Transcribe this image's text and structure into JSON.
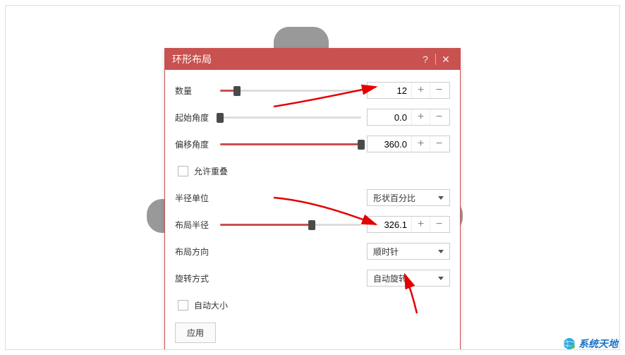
{
  "dialog": {
    "title": "环形布局",
    "rows": {
      "count": {
        "label": "数量",
        "value": "12",
        "slider_pct": 12
      },
      "startAngle": {
        "label": "起始角度",
        "value": "0.0",
        "slider_pct": 0
      },
      "offsetAngle": {
        "label": "偏移角度",
        "value": "360.0",
        "slider_pct": 100
      },
      "allowOverlap": {
        "label": "允许重叠"
      },
      "radiusUnit": {
        "label": "半径单位",
        "value": "形状百分比"
      },
      "layoutRadius": {
        "label": "布局半径",
        "value": "326.1",
        "slider_pct": 65
      },
      "direction": {
        "label": "布局方向",
        "value": "顺时针"
      },
      "rotateMode": {
        "label": "旋转方式",
        "value": "自动旋转"
      },
      "autoSize": {
        "label": "自动大小"
      }
    },
    "applyBtn": "应用"
  },
  "watermark": "系统天地"
}
